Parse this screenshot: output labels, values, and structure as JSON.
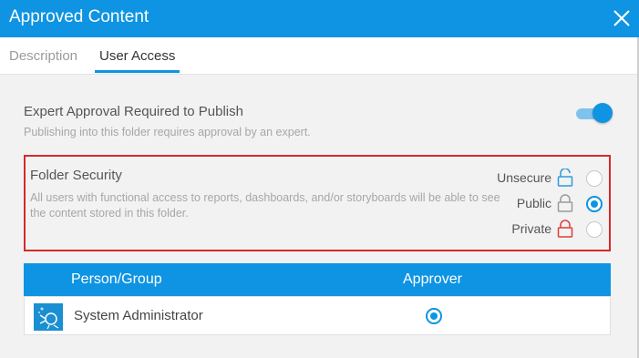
{
  "dialog": {
    "title": "Approved Content",
    "close_icon": "close-icon"
  },
  "tabs": [
    {
      "label": "Description",
      "active": false
    },
    {
      "label": "User Access",
      "active": true
    }
  ],
  "expert_approval": {
    "title": "Expert Approval Required to Publish",
    "subtitle": "Publishing into this folder requires approval by an expert.",
    "enabled": true
  },
  "folder_security": {
    "title": "Folder Security",
    "description": "All users with functional access to reports, dashboards, and/or storyboards will be able to see the content stored in this folder.",
    "options": [
      {
        "label": "Unsecure",
        "icon": "unlocked-icon",
        "color": "#2a9be0",
        "selected": false
      },
      {
        "label": "Public",
        "icon": "lock-icon",
        "color": "#9a9a9a",
        "selected": true
      },
      {
        "label": "Private",
        "icon": "lock-icon",
        "color": "#e23a3a",
        "selected": false
      }
    ]
  },
  "access_table": {
    "columns": [
      "Person/Group",
      "Approver"
    ],
    "rows": [
      {
        "name": "System Administrator",
        "approver": true,
        "icon": "user-avatar-icon"
      }
    ]
  },
  "colors": {
    "accent": "#0e94e2",
    "highlight_border": "#d42a2a"
  }
}
